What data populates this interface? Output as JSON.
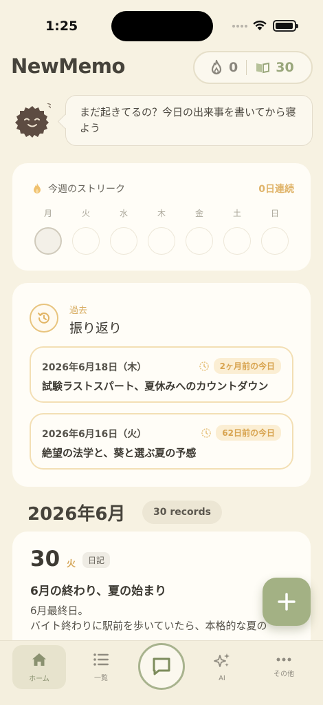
{
  "status_bar": {
    "time": "1:25"
  },
  "header": {
    "app_title": "NewMemo",
    "streak_value": "0",
    "records_value": "30"
  },
  "mascot": {
    "message": "まだ起きてるの？今日の出来事を書いてから寝よう"
  },
  "streak": {
    "title": "今週のストリーク",
    "count": "0日連続",
    "days": [
      "月",
      "火",
      "水",
      "木",
      "金",
      "土",
      "日"
    ]
  },
  "review": {
    "subtitle": "過去",
    "title": "振り返り",
    "memories": [
      {
        "date": "2026年6月18日（木）",
        "badge": "2ヶ月前の今日",
        "title": "試験ラストスパート、夏休みへのカウントダウン"
      },
      {
        "date": "2026年6月16日（火）",
        "badge": "62日前の今日",
        "title": "絶望の法学と、葵と選ぶ夏の予感"
      }
    ]
  },
  "month": {
    "title": "2026年6月",
    "records": "30 records"
  },
  "entry": {
    "day": "30",
    "weekday": "火",
    "tag": "日記",
    "title": "6月の終わり、夏の始まり",
    "body_line1": "6月最終日。",
    "body_line2": "バイト終わりに駅前を歩いていたら、本格的な夏の"
  },
  "tabs": {
    "home": "ホーム",
    "list": "一覧",
    "ai": "AI",
    "other": "その他"
  },
  "colors": {
    "background": "#f7f2e2",
    "accent_green": "#a3b184",
    "accent_gold": "#e0b46a"
  }
}
